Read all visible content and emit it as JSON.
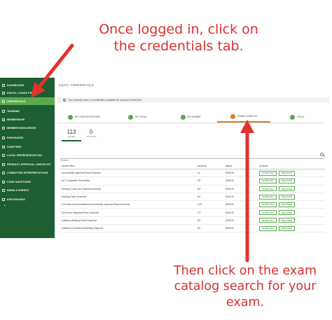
{
  "captions": {
    "top_line1": "Once logged in, click on",
    "top_line2": "the credentials tab.",
    "bottom_line1": "Then click on the exam",
    "bottom_line2": "catalog search for your",
    "bottom_line3": "exam."
  },
  "sidebar": {
    "items": [
      {
        "label": "DASHBOARD"
      },
      {
        "label": "DIGITAL CODES PREM"
      },
      {
        "label": "CREDENTIALS"
      },
      {
        "label": "TRAINING"
      },
      {
        "label": "MEMBERSHIP"
      },
      {
        "label": "MEMBER RESOURCES"
      },
      {
        "label": "PURCHASES"
      },
      {
        "label": "CHAPTERS"
      },
      {
        "label": "LOCAL REPRESENTATIVES"
      },
      {
        "label": "PRODUCT APPROVAL CHECKLIST"
      },
      {
        "label": "COMMITTEE INTERPRETATIONS"
      },
      {
        "label": "CODE ADOPTIONS"
      },
      {
        "label": "NEWS & EVENTS"
      },
      {
        "label": "DISCUSSIONS"
      }
    ],
    "collapse": "‹"
  },
  "app": {
    "title": "myICC CREDENTIALS",
    "info": "You currently have no certificates available for renewal at this time.",
    "tabs": [
      {
        "label": "MY CERTIFICATIONS"
      },
      {
        "label": "MY CEUs"
      },
      {
        "label": "MY EXAMS"
      },
      {
        "label": "EXAM CATALOG"
      },
      {
        "label": "CEUs"
      }
    ],
    "counts": [
      {
        "num": "113",
        "label": "EXAMS"
      },
      {
        "num": "0",
        "label": "PC EXAM"
      }
    ],
    "search_placeholder": "Search",
    "columns": {
      "title": "EXAM TITLE",
      "code": "EXAM ID",
      "price": "PRICE",
      "action": "ACTION"
    },
    "more_info": "MORE INFO",
    "register": "REGISTER",
    "rows": [
      {
        "title": "Accessibility Inspector/Plans Examiner",
        "code": "21",
        "price": "$299.00"
      },
      {
        "title": "ACT Installation Retrofitting",
        "code": "LR",
        "price": "$299.00"
      },
      {
        "title": "Building Codes and Standards Module",
        "code": "BC",
        "price": "$299.00"
      },
      {
        "title": "Building Plans Examiner",
        "code": "B3",
        "price": "$299.00"
      },
      {
        "title": "CA Public Accommodations Accessibility Inspector/Plans Examiner",
        "code": "CAP",
        "price": "$299.00"
      },
      {
        "title": "Cal Green Inspector/Plans Examiner",
        "code": "GT",
        "price": "$299.00"
      },
      {
        "title": "California Building Plans Examiner",
        "code": "B3",
        "price": "$299.00"
      },
      {
        "title": "California Commercial Building Inspector",
        "code": "B2",
        "price": "$299.00"
      }
    ]
  }
}
